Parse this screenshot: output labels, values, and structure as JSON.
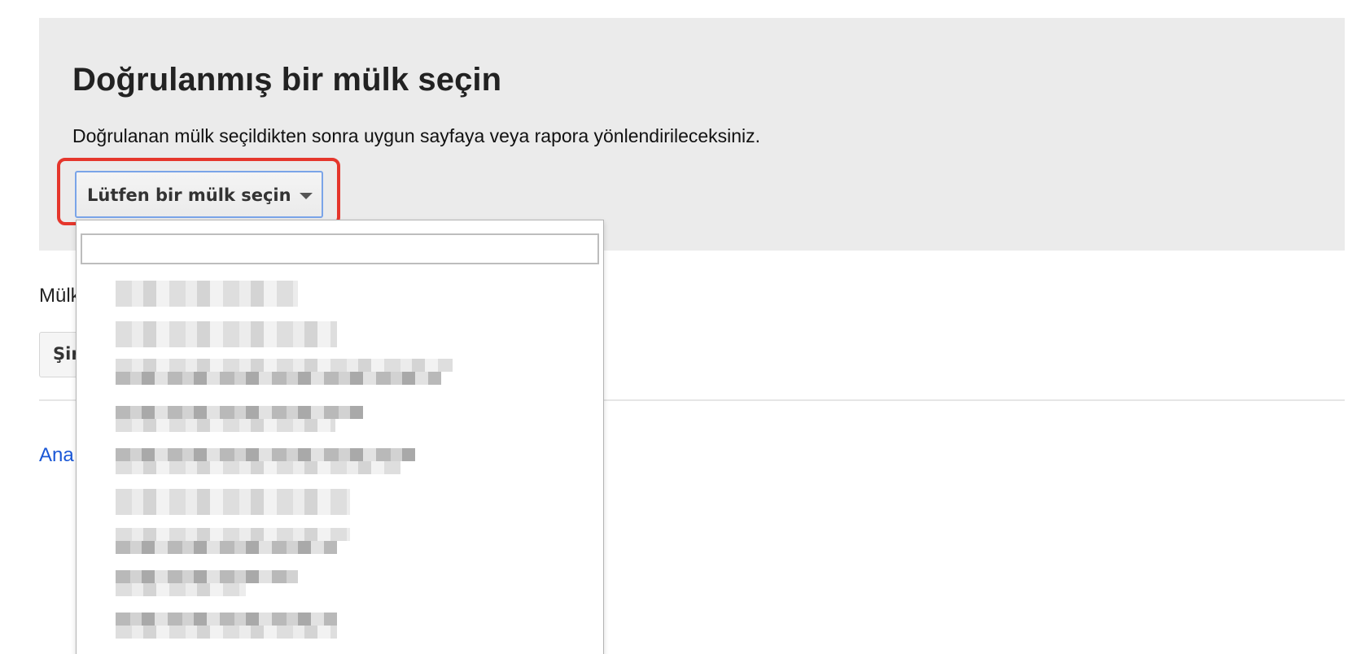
{
  "header": {
    "title": "Doğrulanmış bir mülk seçin",
    "description": "Doğrulanan mülk seçildikten sonra uygun sayfaya veya rapora yönlendirileceksiniz."
  },
  "property_select": {
    "label": "Lütfen bir mülk seçin",
    "search_value": "",
    "options_count": 9
  },
  "background": {
    "section_label": "Mülk",
    "button_label": "Şir",
    "link_text": "Ana"
  },
  "colors": {
    "banner_bg": "#ebebeb",
    "highlight_border": "#e5362c",
    "link": "#1a57d6"
  }
}
